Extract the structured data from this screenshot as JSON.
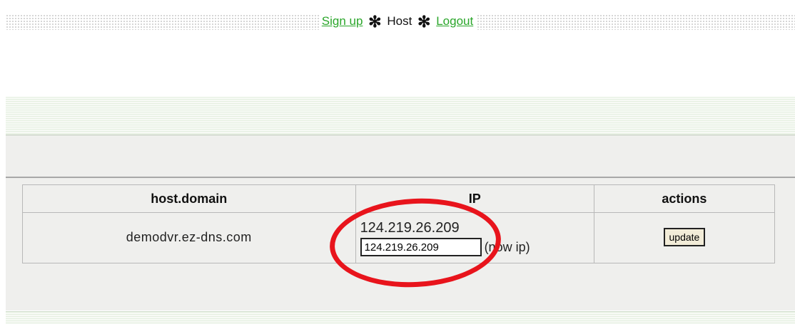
{
  "nav": {
    "signup_label": "Sign up",
    "host_label": "Host",
    "logout_label": "Logout",
    "separator": "✻"
  },
  "table": {
    "headers": [
      "host.domain",
      "IP",
      "actions"
    ],
    "rows": [
      {
        "domain": "demodvr.ez-dns.com",
        "current_ip": "124.219.26.209",
        "ip_input_value": "124.219.26.209",
        "now_ip_label": "(now ip)",
        "action_label": "update"
      }
    ]
  },
  "colors": {
    "link": "#2aa62a",
    "annotation_ring": "#e8141c"
  }
}
